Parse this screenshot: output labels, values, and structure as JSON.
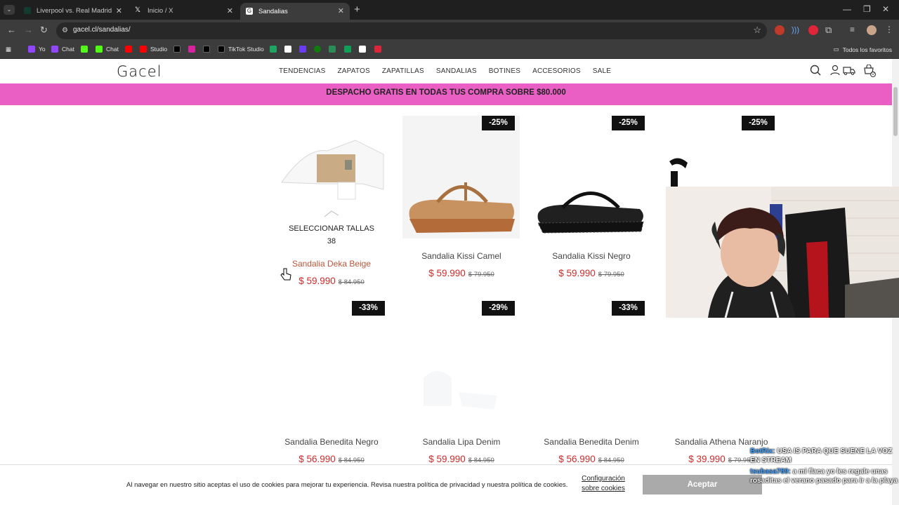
{
  "browser": {
    "tabs": [
      {
        "title": "Liverpool vs. Real Madrid | Disn",
        "active": false
      },
      {
        "title": "Inicio / X",
        "active": false
      },
      {
        "title": "Sandalias",
        "active": true
      }
    ],
    "url": "gacel.cl/sandalias/",
    "bookmarks": [
      "Yo",
      "Chat",
      "Chat",
      "Studio",
      "TikTok Studio"
    ],
    "bookmarks_folder": "Todos los favoritos"
  },
  "site": {
    "logo": "Gacel",
    "nav": [
      "TENDENCIAS",
      "ZAPATOS",
      "ZAPATILLAS",
      "SANDALIAS",
      "BOTINES",
      "ACCESORIOS",
      "SALE"
    ],
    "cart_count": "0",
    "promo": "DESPACHO GRATIS EN TODAS TUS COMPRA SOBRE $80.000"
  },
  "products": [
    {
      "name": "Sandalia Deka Beige",
      "price": "$ 59.990",
      "old_price": "$ 84.950",
      "badge": "",
      "hovered": true
    },
    {
      "name": "Sandalia Kissi Camel",
      "price": "$ 59.990",
      "old_price": "$ 79.950",
      "badge": "-25%"
    },
    {
      "name": "Sandalia Kissi Negro",
      "price": "$ 59.990",
      "old_price": "$ 79.950",
      "badge": "-25%"
    },
    {
      "name": "",
      "price": "",
      "old_price": "",
      "badge": "-25%"
    },
    {
      "name": "Sandalia Benedita Negro",
      "price": "$ 56.990",
      "old_price": "$ 84.950",
      "badge": "-33%"
    },
    {
      "name": "Sandalia Lipa Denim",
      "price": "$ 59.990",
      "old_price": "$ 84.950",
      "badge": "-29%"
    },
    {
      "name": "Sandalia Benedita Denim",
      "price": "$ 56.990",
      "old_price": "$ 84.950",
      "badge": "-33%"
    },
    {
      "name": "Sandalia Athena Naranjo",
      "price": "$ 39.990",
      "old_price": "$ 79.950",
      "badge": ""
    }
  ],
  "hover_panel": {
    "select_label": "SELECCIONAR TALLAS",
    "size": "38"
  },
  "cookie": {
    "text": "Al navegar en nuestro sitio aceptas el uso de cookies para mejorar tu experiencia. Revisa nuestra política de privacidad y nuestra política de cookies.",
    "config_label": "Configuración sobre cookies",
    "accept_label": "Aceptar"
  },
  "stream_chat": [
    {
      "user": "BotRix:",
      "message": "USA IS PARA QUE SUENE LA VOZ EN STREAM"
    },
    {
      "user": "tsubasa789:",
      "message": "a mi flaca yo les regale unas rosaditas el verano pasado para ir a la playa"
    }
  ],
  "colors": {
    "promo": "#e95fc3",
    "price": "#d22a2a",
    "badge": "#111111",
    "accept": "#aaaaaa"
  }
}
